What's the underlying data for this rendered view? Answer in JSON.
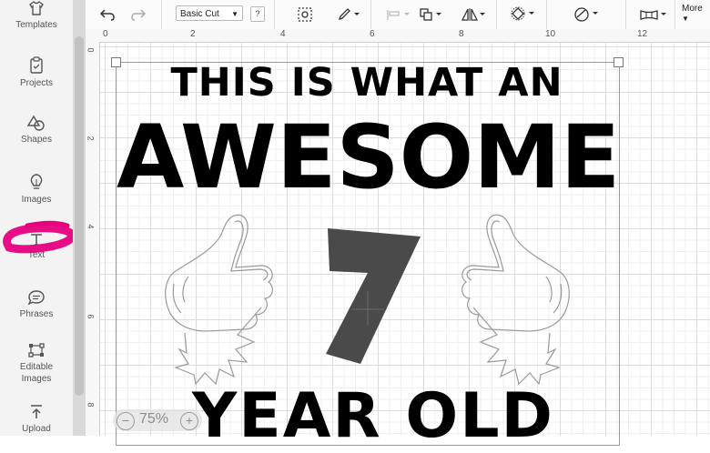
{
  "sidebar": {
    "items": [
      {
        "label": "Templates",
        "icon": "shirt-icon"
      },
      {
        "label": "Projects",
        "icon": "clipboard-icon"
      },
      {
        "label": "Shapes",
        "icon": "shapes-icon"
      },
      {
        "label": "Images",
        "icon": "lightbulb-icon"
      },
      {
        "label": "Text",
        "icon": "text-icon"
      },
      {
        "label": "Phrases",
        "icon": "speech-bubble-icon"
      },
      {
        "label": "Editable Images",
        "icon": "edit-nodes-icon"
      },
      {
        "label": "Upload",
        "icon": "upload-icon"
      }
    ],
    "highlight_color": "#e6007e"
  },
  "toolbar": {
    "undo_icon": "undo-icon",
    "redo_icon": "redo-icon",
    "operation_value": "Basic Cut",
    "help_label": "?",
    "more_label": "More"
  },
  "rulers": {
    "top": [
      "0",
      "2",
      "4",
      "6",
      "8",
      "10",
      "12"
    ],
    "left": [
      "0",
      "2",
      "4",
      "6",
      "8"
    ]
  },
  "design": {
    "line1": "THIS IS WHAT AN",
    "line2": "AWESOME",
    "number": "7",
    "line3": "YEAR OLD",
    "number_color": "#4a4a4a"
  },
  "zoom": {
    "minus": "−",
    "value": "75%",
    "plus": "+"
  }
}
